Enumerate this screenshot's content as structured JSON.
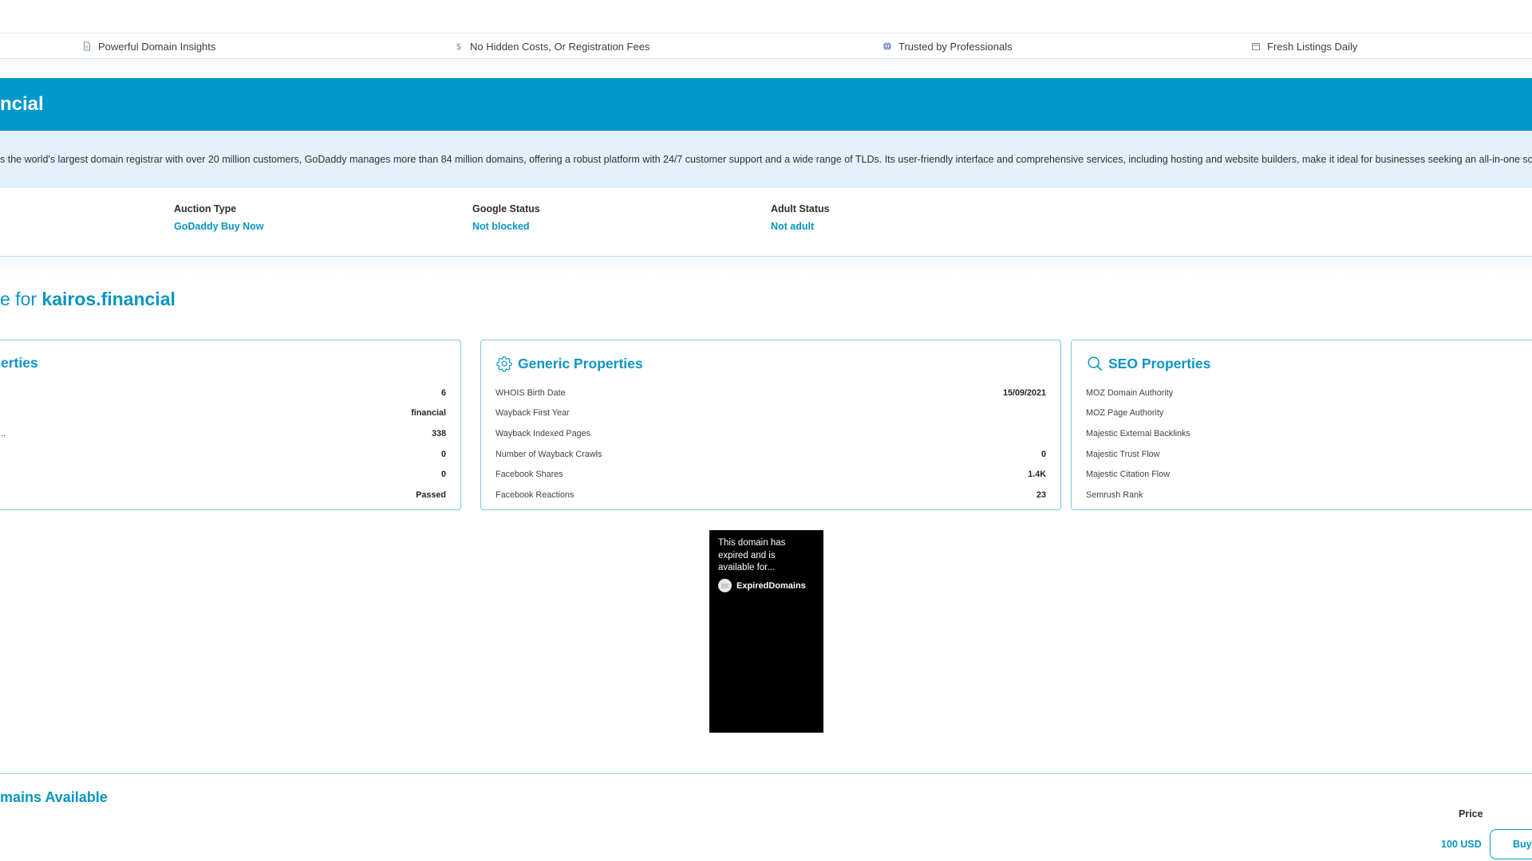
{
  "features": [
    {
      "icon": "document-icon",
      "label": "Powerful Domain Insights"
    },
    {
      "icon": "dollar-icon",
      "label": "No Hidden Costs, Or Registration Fees"
    },
    {
      "icon": "globe-icon",
      "label": "Trusted by Professionals"
    },
    {
      "icon": "calendar-icon",
      "label": "Fresh Listings Daily"
    }
  ],
  "hero": {
    "title": "ncial"
  },
  "blurb": "s the world's largest domain registrar with over 20 million customers, GoDaddy manages more than 84 million domains, offering a robust platform with 24/7 customer support and a wide range of TLDs. Its user-friendly interface and comprehensive services, including hosting and website builders, make it ideal for businesses seeking an all-in-one solu",
  "status": {
    "auction_type": {
      "label": "Auction Type",
      "value": "GoDaddy Buy Now"
    },
    "google_status": {
      "label": "Google Status",
      "value": "Not blocked"
    },
    "adult_status": {
      "label": "Adult Status",
      "value": "Not adult"
    }
  },
  "section": {
    "prefix": "e for ",
    "domain": "kairos.financial"
  },
  "cards": {
    "left": {
      "title": "erties",
      "rows": [
        {
          "label": "",
          "value": "6"
        },
        {
          "label": "",
          "value": "financial"
        },
        {
          "label": "..",
          "value": "338"
        },
        {
          "label": "",
          "value": "0"
        },
        {
          "label": "",
          "value": "0"
        },
        {
          "label": "",
          "value": "Passed"
        }
      ]
    },
    "generic": {
      "icon": "gear-icon",
      "title": "Generic Properties",
      "rows": [
        {
          "label": "WHOIS Birth Date",
          "value": "15/09/2021"
        },
        {
          "label": "Wayback First Year",
          "value": ""
        },
        {
          "label": "Wayback Indexed Pages",
          "value": ""
        },
        {
          "label": "Number of Wayback Crawls",
          "value": "0"
        },
        {
          "label": "Facebook Shares",
          "value": "1.4K"
        },
        {
          "label": "Facebook Reactions",
          "value": "23"
        }
      ]
    },
    "seo": {
      "icon": "search-icon",
      "title": "SEO Properties",
      "rows": [
        {
          "label": "MOZ Domain Authority",
          "value": ""
        },
        {
          "label": "MOZ Page Authority",
          "value": ""
        },
        {
          "label": "Majestic External Backlinks",
          "value": ""
        },
        {
          "label": "Majestic Trust Flow",
          "value": ""
        },
        {
          "label": "Majestic Citation Flow",
          "value": ""
        },
        {
          "label": "Semrush Rank",
          "value": ""
        }
      ]
    }
  },
  "preview": {
    "text": "This domain has expired and is available for...",
    "brand": "ExpiredDomains"
  },
  "available": {
    "heading": "mains Available",
    "price_label": "Price",
    "price_value": "100 USD",
    "buy_label": "Buy"
  }
}
